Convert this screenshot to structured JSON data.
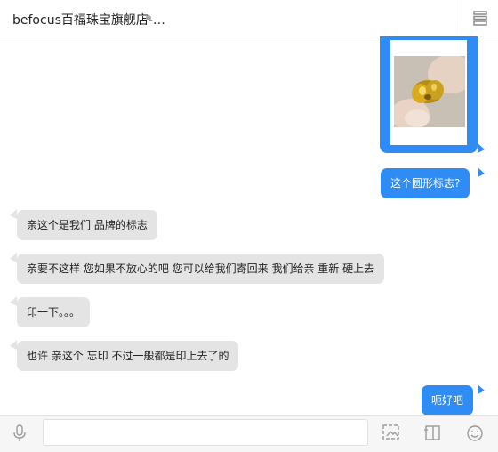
{
  "header": {
    "title": "befocus百福珠宝旗舰店-…",
    "store_icon": "store-icon"
  },
  "messages": [
    {
      "side": "right",
      "type": "image",
      "content": "gold-pendant-photo"
    },
    {
      "side": "right",
      "type": "text",
      "text": "这个圆形标志?"
    },
    {
      "side": "left",
      "type": "text",
      "text": "亲这个是我们 品牌的标志"
    },
    {
      "side": "left",
      "type": "text",
      "text": "亲要不这样  您如果不放心的吧   您可以给我们寄回来 我们给亲 重新 硬上去"
    },
    {
      "side": "left",
      "type": "text",
      "text": "印一下。。。"
    },
    {
      "side": "left",
      "type": "text",
      "text": "也许 亲这个 忘印 不过一般都是印上去了的"
    },
    {
      "side": "right",
      "type": "text",
      "text": "呃好吧"
    }
  ],
  "footer": {
    "input_value": "",
    "icons": [
      "microphone-icon",
      "image-icon",
      "crop-icon",
      "emoji-icon"
    ]
  },
  "colors": {
    "outgoing_bubble": "#2f8cf4",
    "incoming_bubble": "#e4e4e4",
    "background": "#ffffff"
  }
}
